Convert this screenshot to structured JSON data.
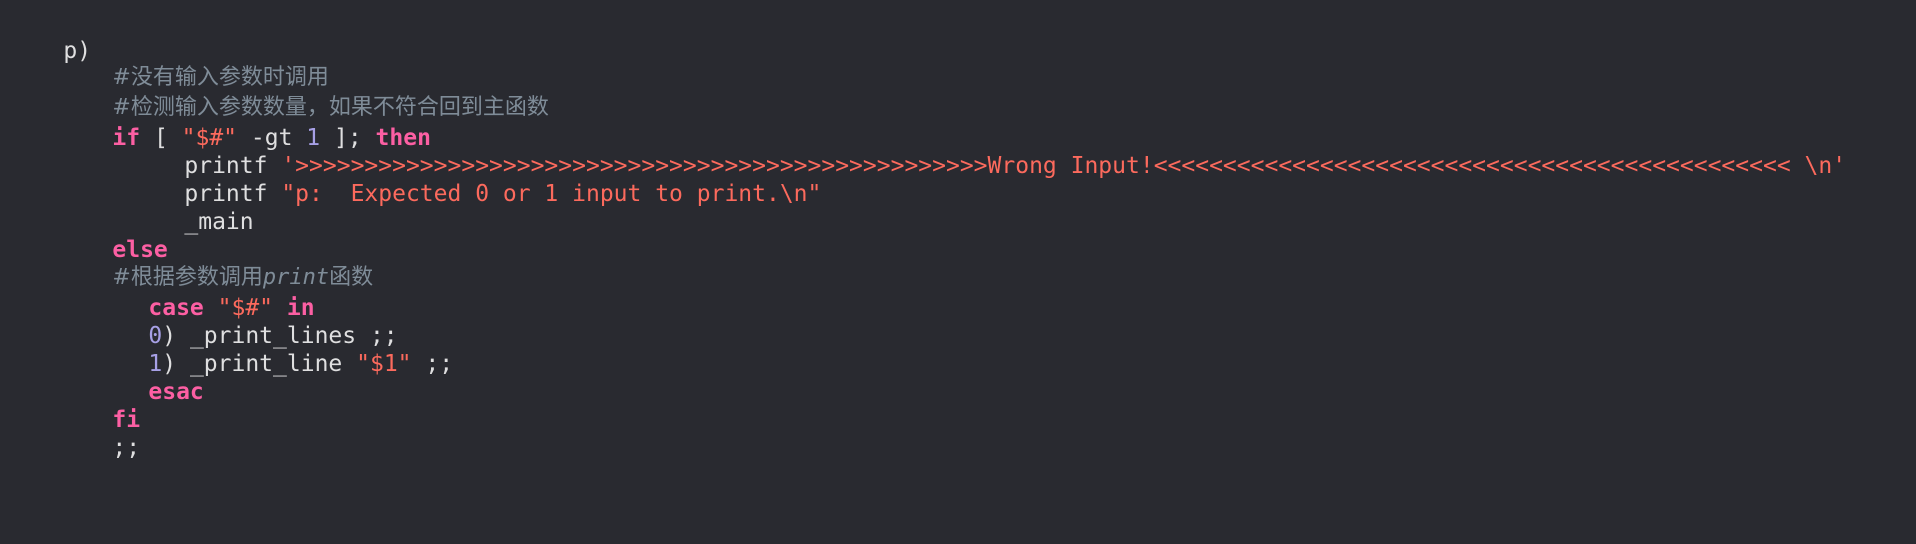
{
  "code": {
    "line1": {
      "text": "p)"
    },
    "line2": {
      "comment": "#没有输入参数时调用"
    },
    "line3": {
      "comment": "#检测输入参数数量，如果不符合回到主函数"
    },
    "line4": {
      "kw_if": "if",
      "bracket_open": " [ ",
      "str_arg": "\"$#\"",
      "op": " -gt ",
      "num": "1",
      "bracket_close": " ]; ",
      "kw_then": "then"
    },
    "line5": {
      "cmd": "printf ",
      "str": "'>>>>>>>>>>>>>>>>>>>>>>>>>>>>>>>>>>>>>>>>>>>>>>>>>>Wrong Input!<<<<<<<<<<<<<<<<<<<<<<<<<<<<<<<<<<<<<<<<<<<<<< \\n'"
    },
    "line6": {
      "cmd": "printf ",
      "str": "\"p:  Expected 0 or 1 input to print.\\n\""
    },
    "line7": {
      "text": "_main"
    },
    "line8": {
      "kw": "else"
    },
    "line9": {
      "comment_a": "#根据参数调用",
      "comment_b": "print",
      "comment_c": "函数"
    },
    "line10": {
      "kw_case": "case",
      "space": " ",
      "str": "\"$#\"",
      "space2": " ",
      "kw_in": "in"
    },
    "line11": {
      "num": "0",
      "text": ") _print_lines ;;"
    },
    "line12": {
      "num": "1",
      "text": ") _print_line ",
      "str": "\"$1\"",
      "tail": " ;;"
    },
    "line13": {
      "kw": "esac"
    },
    "line14": {
      "kw": "fi"
    },
    "line15": {
      "text": ";;"
    }
  }
}
